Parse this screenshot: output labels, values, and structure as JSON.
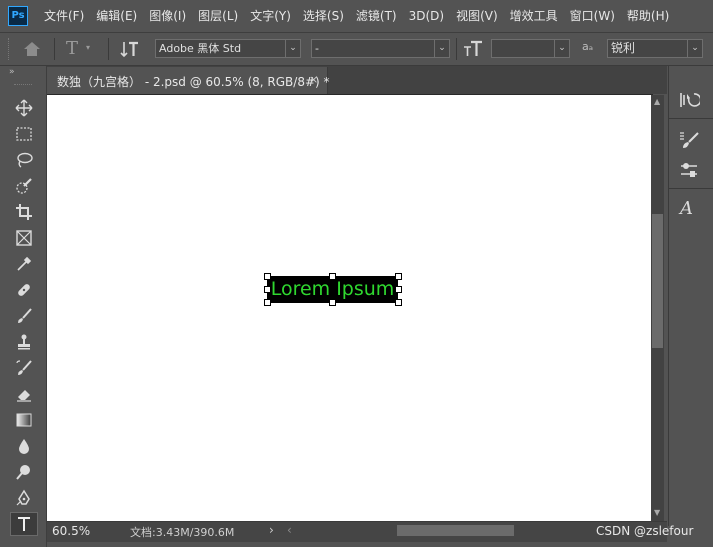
{
  "app": {
    "logo_text": "Ps"
  },
  "menu": [
    "文件(F)",
    "编辑(E)",
    "图像(I)",
    "图层(L)",
    "文字(Y)",
    "选择(S)",
    "滤镜(T)",
    "3D(D)",
    "视图(V)",
    "增效工具",
    "窗口(W)",
    "帮助(H)"
  ],
  "options": {
    "font_family": "Adobe 黑体 Std",
    "font_style": "-",
    "font_size": "",
    "aa_icon_text": "aₐ",
    "anti_alias": "锐利"
  },
  "document": {
    "tab_title": "数独（九宫格） - 2.psd @ 60.5% (8, RGB/8#) *",
    "text_layer_content": "Lorem Ipsum"
  },
  "status": {
    "zoom": "60.5%",
    "doc_info": "文档:3.43M/390.6M"
  },
  "watermark": "CSDN @zslefour",
  "colors": {
    "text_layer_fill": "#2fd82f",
    "text_layer_bg": "#000000",
    "accent": "#31a8ff"
  }
}
